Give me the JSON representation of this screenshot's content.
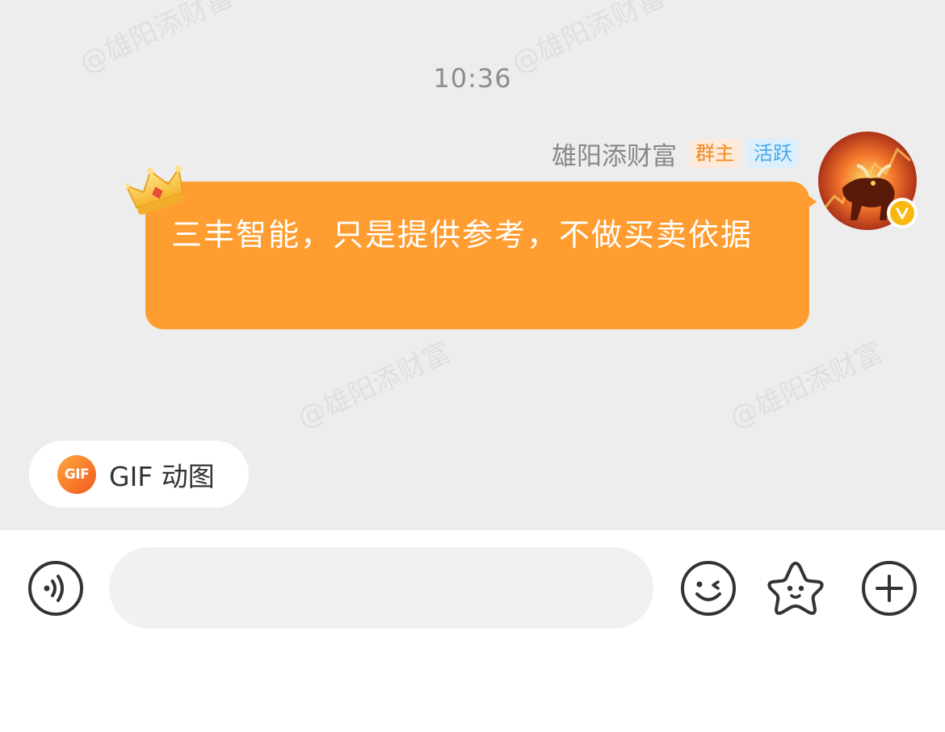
{
  "chat": {
    "timestamp": "10:36",
    "watermark_text": "@雄阳添财富",
    "message": {
      "sender_name": "雄阳添财富",
      "badges": [
        "群主",
        "活跃"
      ],
      "text": "三丰智能，只是提供参考，不做买卖依据",
      "bubble_color": "#ff9d31"
    }
  },
  "gif_shortcut": {
    "icon_text": "GIF",
    "label": "GIF 动图"
  },
  "input_bar": {
    "voice_icon": "voice-icon",
    "emoji_icon": "emoji-icon",
    "sticker_icon": "star-sticker-icon",
    "add_icon": "plus-circle-icon"
  }
}
